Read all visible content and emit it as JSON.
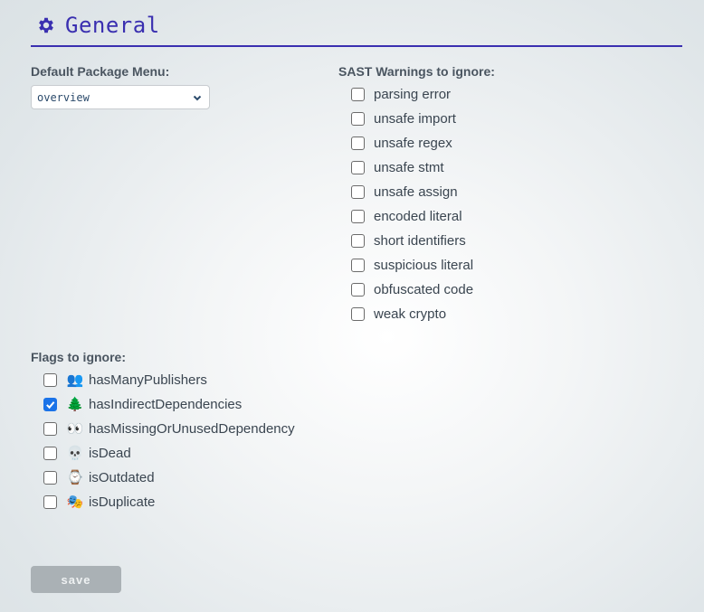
{
  "header": {
    "title": "General"
  },
  "package_menu": {
    "label": "Default Package Menu:",
    "value": "overview"
  },
  "sast": {
    "label": "SAST Warnings to ignore:",
    "items": [
      {
        "label": "parsing error",
        "checked": false
      },
      {
        "label": "unsafe import",
        "checked": false
      },
      {
        "label": "unsafe regex",
        "checked": false
      },
      {
        "label": "unsafe stmt",
        "checked": false
      },
      {
        "label": "unsafe assign",
        "checked": false
      },
      {
        "label": "encoded literal",
        "checked": false
      },
      {
        "label": "short identifiers",
        "checked": false
      },
      {
        "label": "suspicious literal",
        "checked": false
      },
      {
        "label": "obfuscated code",
        "checked": false
      },
      {
        "label": "weak crypto",
        "checked": false
      }
    ]
  },
  "flags": {
    "label": "Flags to ignore:",
    "items": [
      {
        "label": "hasManyPublishers",
        "emoji": "👥",
        "checked": false
      },
      {
        "label": "hasIndirectDependencies",
        "emoji": "🌲",
        "checked": true
      },
      {
        "label": "hasMissingOrUnusedDependency",
        "emoji": "👀",
        "checked": false
      },
      {
        "label": "isDead",
        "emoji": "💀",
        "checked": false
      },
      {
        "label": "isOutdated",
        "emoji": "⌚",
        "checked": false
      },
      {
        "label": "isDuplicate",
        "emoji": "🎭",
        "checked": false
      }
    ]
  },
  "save_label": "save"
}
